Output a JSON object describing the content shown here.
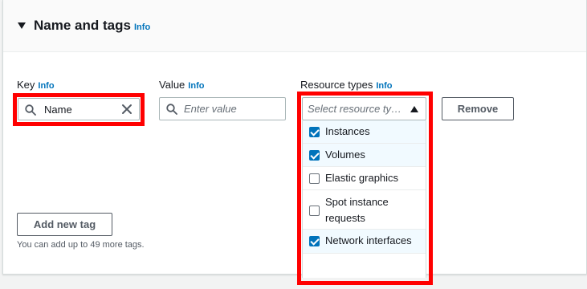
{
  "section": {
    "title": "Name and tags",
    "info": "Info"
  },
  "key": {
    "label": "Key",
    "info": "Info",
    "value": "Name"
  },
  "value_field": {
    "label": "Value",
    "info": "Info",
    "placeholder": "Enter value"
  },
  "resource_types": {
    "label": "Resource types",
    "info": "Info",
    "placeholder": "Select resource ty…",
    "options": [
      {
        "label": "Instances",
        "checked": true
      },
      {
        "label": "Volumes",
        "checked": true
      },
      {
        "label": "Elastic graphics",
        "checked": false
      },
      {
        "label": "Spot instance requests",
        "label_line1": "Spot instance",
        "label_line2": "requests",
        "checked": false
      },
      {
        "label": "Network interfaces",
        "checked": true
      }
    ]
  },
  "remove_button": "Remove",
  "add_tag_button": "Add new tag",
  "hint": "You can add up to 49 more tags.",
  "colors": {
    "link": "#0073bb",
    "highlight": "#ff0000",
    "checkbox_checked": "#0073bb",
    "selected_row": "#f1faff"
  }
}
